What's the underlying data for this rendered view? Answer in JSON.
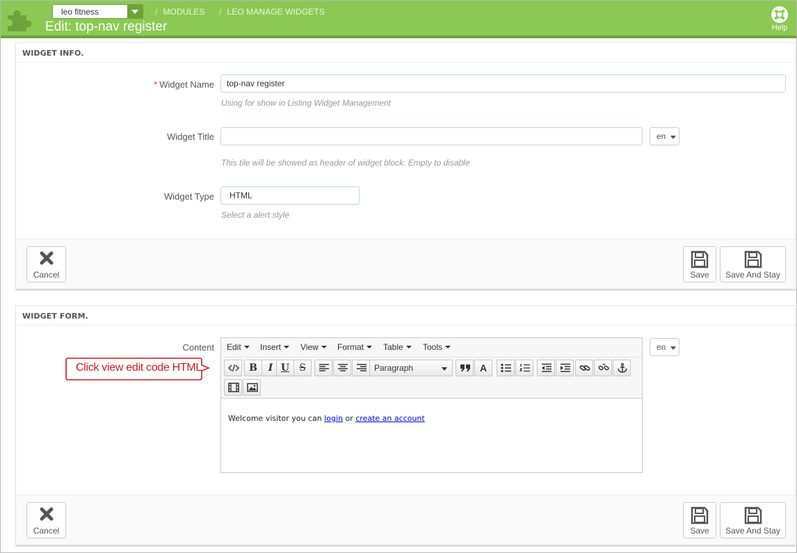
{
  "header": {
    "shop_selector": "leo fitness",
    "breadcrumb": [
      "MODULES",
      "LEO MANAGE WIDGETS"
    ],
    "page_title": "Edit: top-nav register",
    "help_label": "Help",
    "bar_color": "#8bc954"
  },
  "widget_info": {
    "heading": "WIDGET INFO.",
    "name_label": "Widget Name",
    "name_required": "*",
    "name_value": "top-nav register",
    "name_hint": "Using for show in Listing Widget Management",
    "title_label": "Widget Title",
    "title_value": "",
    "title_lang": "en",
    "title_hint": "This tile will be showed as header of widget block. Empty to disable",
    "type_label": "Widget Type",
    "type_value": "HTML",
    "type_hint": "Select a alert style",
    "cancel_label": "Cancel",
    "save_label": "Save",
    "save_stay_label": "Save And Stay"
  },
  "widget_form": {
    "heading": "WIDGET FORM.",
    "content_label": "Content",
    "content_lang": "en",
    "menus": [
      "Edit",
      "Insert",
      "View",
      "Format",
      "Table",
      "Tools"
    ],
    "toolbar": {
      "code_icon": "code-view-icon",
      "format_select": "Paragraph"
    },
    "content": {
      "prefix": "Welcome visitor you can ",
      "login_link": "login",
      "middle": " or ",
      "create_link": "create an account"
    },
    "cancel_label": "Cancel",
    "save_label": "Save",
    "save_stay_label": "Save And Stay"
  },
  "annotation": {
    "callout_text": "Click view edit code HTML",
    "color": "#d0191e"
  }
}
